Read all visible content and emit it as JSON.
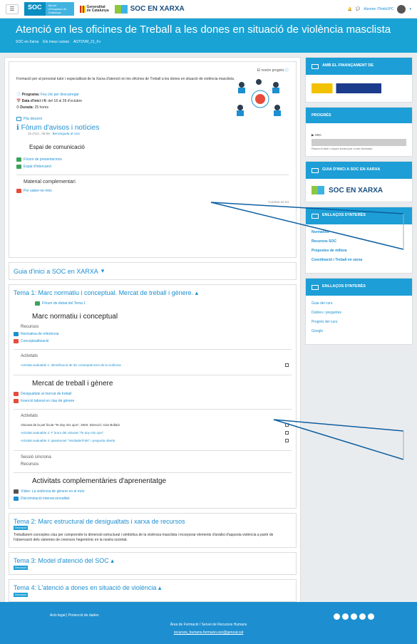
{
  "topbar": {
    "menu_icon": "☰",
    "soc_label": "SOC",
    "soc_sub": "Servei d'Ocupació de Catalunya",
    "gen_label_1": "Generalitat",
    "gen_label_2": "de Catalunya",
    "soc_xarxa": "SOC EN XARXA",
    "user_name": "Alumne iThinkUPC"
  },
  "hero": {
    "title": "Atenció en les oficines de Treball a les dones en situació de violència masclista",
    "crumbs": [
      "SOC en Xarxa",
      "Els meus cursos",
      "AOTDVM_21_Fv"
    ]
  },
  "intro": {
    "progress_label": "El vostre progrés",
    "description": "Formació per al personal tutor i especialitzat de la Xarxa d'atenció en les oficines de Treball a les dones en situació de violència masclista.",
    "programa_label": "Programa:",
    "programa_value": "Feu clic per descarregar",
    "data_label": "Data d'inici i fi:",
    "data_value": "del 18 al 28 d'octubre",
    "durada_label": "Durada:",
    "durada_value": "25 hores",
    "pla_docent": "Pla docent",
    "forum_title": "Fòrum d'avisos i notícies",
    "forum_sub_date": "15 d'oct., 09:09",
    "forum_sub_link": "Benvinguda al curs",
    "espai_title": "Espai de comunicació",
    "espai_links": [
      "Fòrum de presentacions",
      "Espai d'intercanvi"
    ],
    "material_title": "Material complementari",
    "material_link": "Per saber-ne més",
    "contraure": "Contrau-ne tot"
  },
  "guia_section": "Guia d'inici a SOC en XARXA",
  "tema1": {
    "title": "Tema 1: Marc normatiu i conceptual. Mercat de treball i gènere.",
    "forum": "Fòrum de debat del Tema 1",
    "marc_title": "Marc normatiu i conceptual",
    "recursos": "Recursos",
    "marc_links": [
      "Normativa de referència",
      "Conceptualització"
    ],
    "activitats": "Activitats",
    "act1": "Activitat avaluable 1: Identificació de les conseqüències de la violència",
    "mercat_title": "Mercat de treball i gènere",
    "mercat_links": [
      "Desigualtats al mercat de treball",
      "Inserció laboral en clau de gènere"
    ],
    "activitats2": "Activitats",
    "act2_list": [
      "Visionat de la pel·lícula \"Te doy mis ojos\", 2003. Direcció: Icíar Bollaín",
      "Activitat avaluable 2: F`òrum del visionat \"Te doy mis ojos\"",
      "Activitat avaluable 3: qüestionari \"Verdader/Fals\" i pregunta oberta"
    ],
    "sessio": "Sessió síncrona",
    "recursos2": "Recursos",
    "compl_title": "Activitats complementàries d'aprenentatge",
    "compl_links": [
      "Vídeo: La violència de gènere en el món",
      "Discriminació interseccionalitat"
    ]
  },
  "tema2": {
    "title": "Tema 2: Marc estructural de desigualtats i xarxa de recursos",
    "badge": "Descripció",
    "text": "Treballarem conceptes clau per comprendre la dimensió estructural i simbòlica de la violència masclista i incorporar elements d'anàlisi d'aquesta violència a partir de l'observació dels sistemes de creences hegemònic en la nostra societat."
  },
  "tema3": {
    "title": "Tema 3: Model d'atenció del SOC",
    "badge": "Descripció"
  },
  "tema4": {
    "title": "Tema 4: L'atenció a dones en situació de violència",
    "badge": "Descripció"
  },
  "side": {
    "fin_title": "AMB EL FINANÇAMENT DE",
    "progres_title": "PROGRÉS",
    "progres_ara": "ARA",
    "progres_note": "Passeu el ratolí o toqueu la barra per a més informació.",
    "guia_title": "GUIA D'INICI A SOC EN XARXA",
    "guia_logo": "SOC EN XARXA",
    "enll1_title": "ENLLAÇOS D'INTERÈS",
    "enll1_links": [
      "Normativa",
      "Recursos SOC",
      "Propostes de millora",
      "Coordinació i Treball en xarxa"
    ],
    "enll2_title": "ENLLAÇOS D'INTERÈS",
    "enll2_links": [
      "Guia del curs",
      "Dubtes i preguntes",
      "Progrés del curs",
      "Google"
    ]
  },
  "footer": {
    "legal": "Avís legal",
    "privacy": "Protecció de dades",
    "area": "Àrea de Formació / Servei de Recursos Humans",
    "email": "recursos_humans.formacio.soc@gencat.cat"
  },
  "colors": {
    "primary": "#19a3d5",
    "link": "#1d8fd1",
    "footer": "#1d8fd1"
  }
}
